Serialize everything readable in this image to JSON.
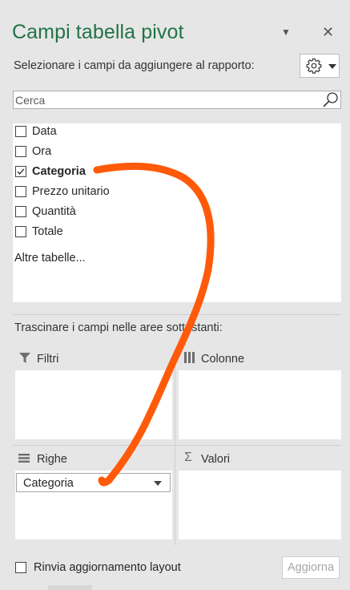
{
  "panel": {
    "title": "Campi tabella pivot",
    "subtitle": "Selezionare i campi da aggiungere al rapporto:",
    "chevron_glyph": "▼",
    "close_glyph": "✕"
  },
  "tools_icon": "gear-icon",
  "search": {
    "placeholder": "Cerca",
    "value": ""
  },
  "fields": [
    {
      "label": "Data",
      "checked": false
    },
    {
      "label": "Ora",
      "checked": false
    },
    {
      "label": "Categoria",
      "checked": true
    },
    {
      "label": "Prezzo unitario",
      "checked": false
    },
    {
      "label": "Quantità",
      "checked": false
    },
    {
      "label": "Totale",
      "checked": false
    }
  ],
  "more_tables": "Altre tabelle...",
  "drag_instruction": "Trascinare i campi nelle aree sottostanti:",
  "areas": {
    "filters": {
      "label": "Filtri",
      "icon": "filter-icon"
    },
    "columns": {
      "label": "Colonne",
      "icon": "columns-icon"
    },
    "rows": {
      "label": "Righe",
      "icon": "rows-icon",
      "items": [
        "Categoria"
      ]
    },
    "values": {
      "label": "Valori",
      "icon": "sigma-icon",
      "glyph": "Σ"
    }
  },
  "defer_update": {
    "label": "Rinvia aggiornamento layout",
    "checked": false
  },
  "update_button": "Aggiorna",
  "colors": {
    "title_green": "#217346",
    "annotation_stroke": "#ff5a0a",
    "panel_bg": "#e6e6e6"
  }
}
